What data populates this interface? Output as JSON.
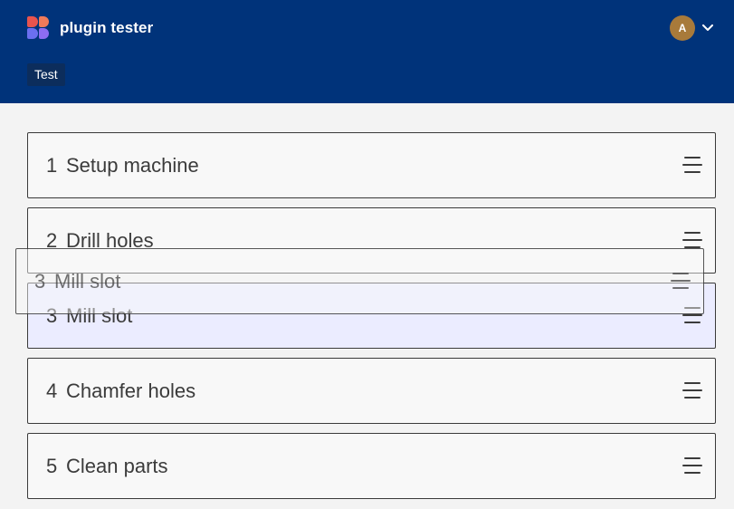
{
  "header": {
    "app_title": "plugin tester",
    "avatar_initial": "A",
    "tab_label": "Test"
  },
  "list": {
    "items": [
      {
        "number": "1",
        "label": "Setup machine"
      },
      {
        "number": "2",
        "label": "Drill holes"
      },
      {
        "number": "3",
        "label": "Mill slot",
        "state": "drop-placeholder"
      },
      {
        "number": "4",
        "label": "Chamfer holes"
      },
      {
        "number": "5",
        "label": "Clean parts"
      }
    ],
    "dragging_item": {
      "number": "3",
      "label": "Mill slot"
    }
  },
  "icons": {
    "logo": "app-logo",
    "user_menu": "chevron-down-icon",
    "drag_handle": "drag-handle-icon"
  },
  "colors": {
    "header_bg": "#00337a",
    "placeholder_bg": "#ebecff",
    "avatar_bg": "#a87a3a"
  }
}
